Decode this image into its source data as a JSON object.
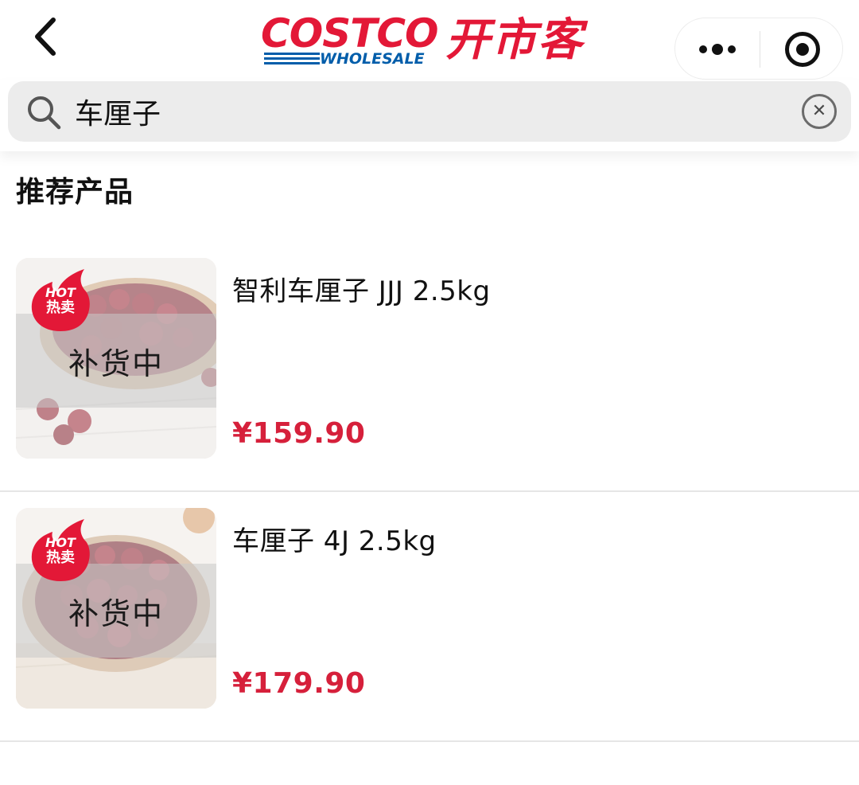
{
  "header": {
    "logo": {
      "brand": "COSTCO",
      "sub": "WHOLESALE",
      "cn": "开市客"
    }
  },
  "search": {
    "value": "车厘子",
    "placeholder": ""
  },
  "section": {
    "title": "推荐产品"
  },
  "products": [
    {
      "name": "智利车厘子 JJJ 2.5kg",
      "price": "¥159.90",
      "status": "补货中",
      "badge_en": "HOT",
      "badge_cn": "热卖"
    },
    {
      "name": "车厘子 4J 2.5kg",
      "price": "¥179.90",
      "status": "补货中",
      "badge_en": "HOT",
      "badge_cn": "热卖"
    }
  ],
  "colors": {
    "brand_red": "#e31837",
    "brand_blue": "#005daa",
    "price_red": "#d6203b"
  },
  "icons": {
    "back": "chevron-left-icon",
    "search": "search-icon",
    "clear": "clear-circle-icon",
    "more": "more-dots-icon",
    "close_mini": "target-circle-icon"
  }
}
